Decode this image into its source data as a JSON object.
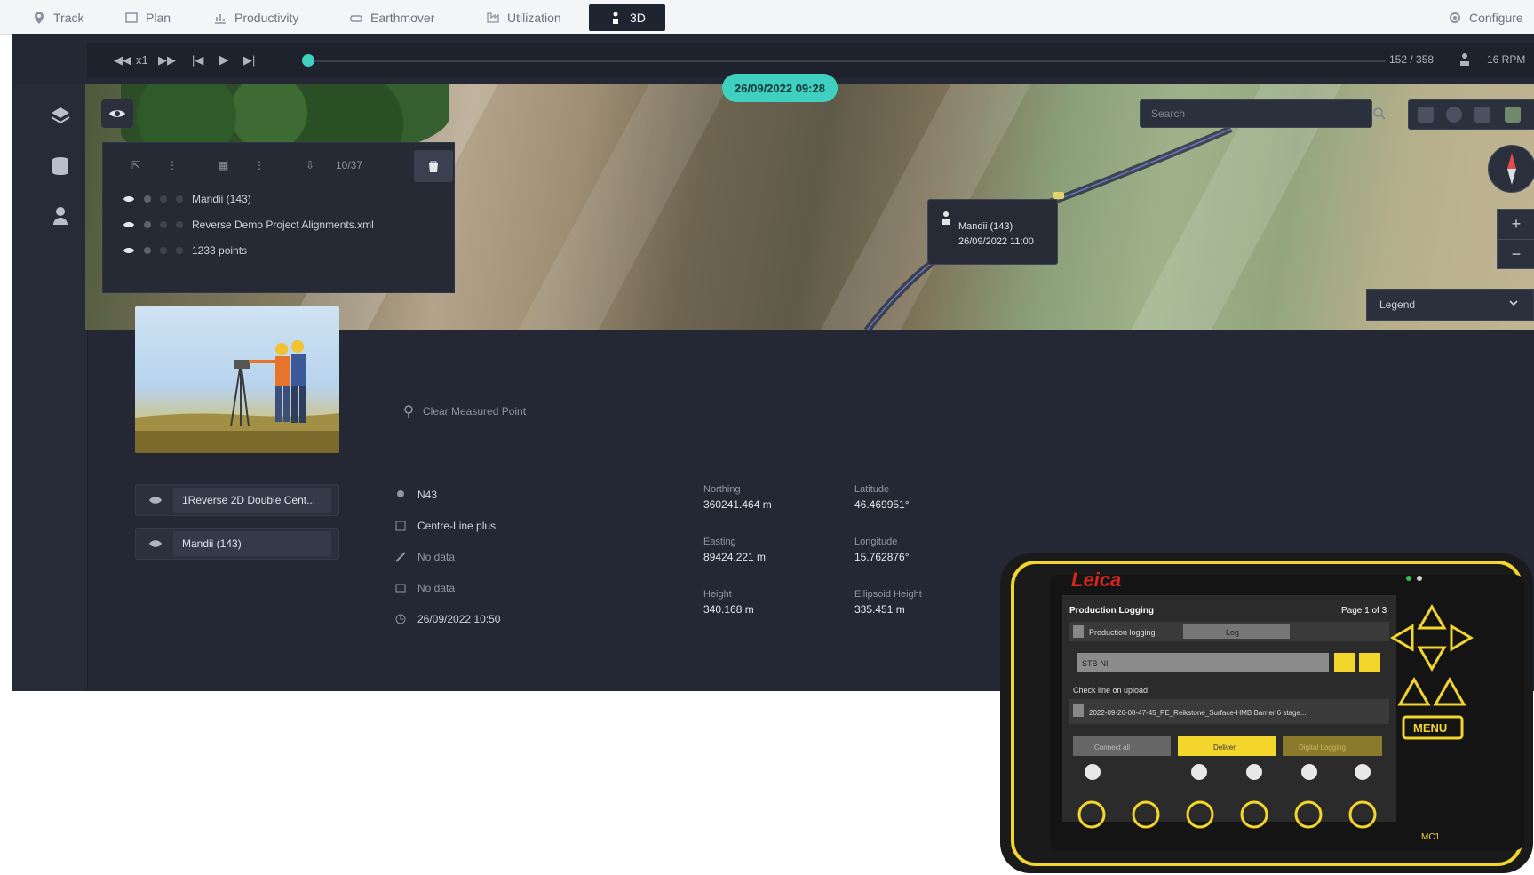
{
  "nav": {
    "tabs": [
      {
        "label": "Track",
        "icon": "pin-icon"
      },
      {
        "label": "Plan",
        "icon": "plan-icon"
      },
      {
        "label": "Productivity",
        "icon": "chart-icon"
      },
      {
        "label": "Earthmover",
        "icon": "earthmover-icon"
      },
      {
        "label": "Utilization",
        "icon": "utilization-icon"
      },
      {
        "label": "3D",
        "icon": "person-icon",
        "active": true
      }
    ],
    "configure_label": "Configure"
  },
  "player": {
    "speed": "x1",
    "counter": "152 / 358",
    "time_label": "16 RPM"
  },
  "map": {
    "date_pill": "26/09/2022 09:28",
    "search_placeholder": "Search",
    "legend_label": "Legend",
    "tooltip": {
      "name": "Mandii (143)",
      "date": "26/09/2022 11:00"
    }
  },
  "layer_panel": {
    "toolbar_count": "10/37",
    "rows": [
      {
        "label": "Mandii (143)"
      },
      {
        "label": "Reverse Demo Project Alignments.xml"
      },
      {
        "label": "1233 points"
      }
    ]
  },
  "lower": {
    "clear_measured": "Clear Measured Point",
    "buttons": [
      {
        "label": "1Reverse 2D Double Cent..."
      },
      {
        "label": "Mandii (143)"
      }
    ],
    "info": [
      {
        "icon": "location-icon",
        "text": "N43"
      },
      {
        "icon": "grid-icon",
        "text": "Centre-Line plus"
      },
      {
        "icon": "ruler-icon",
        "text": "No data"
      },
      {
        "icon": "box-icon",
        "text": "No data"
      },
      {
        "icon": "clock-icon",
        "text": "26/09/2022 10:50"
      }
    ],
    "coords": [
      {
        "label": "Northing",
        "value": "360241.464 m"
      },
      {
        "label": "Latitude",
        "value": "46.469951°"
      },
      {
        "label": "Easting",
        "value": "89424.221 m"
      },
      {
        "label": "Longitude",
        "value": "15.762876°"
      },
      {
        "label": "Height",
        "value": "340.168 m"
      },
      {
        "label": "Ellipsoid Height",
        "value": "335.451 m"
      }
    ]
  },
  "device": {
    "brand": "Leica",
    "screen_title": "Production Logging",
    "page": "Page 1 of 3",
    "toggle_label": "Production logging",
    "toggle_value": "Log",
    "input_value": "STB-NI",
    "check_label": "Check line on upload",
    "file_name": "2022-09-26-08-47-45_PE_Reikstone_Surface-HMB Barrier 6 stage...",
    "btn_left": "Connect all",
    "btn_mid": "Deliver",
    "btn_right": "Digital Logging",
    "menu_label": "MENU",
    "model": "MC1"
  },
  "colors": {
    "accent": "#3fd0c0",
    "panel": "#232834",
    "device_yellow": "#f3d52b"
  }
}
